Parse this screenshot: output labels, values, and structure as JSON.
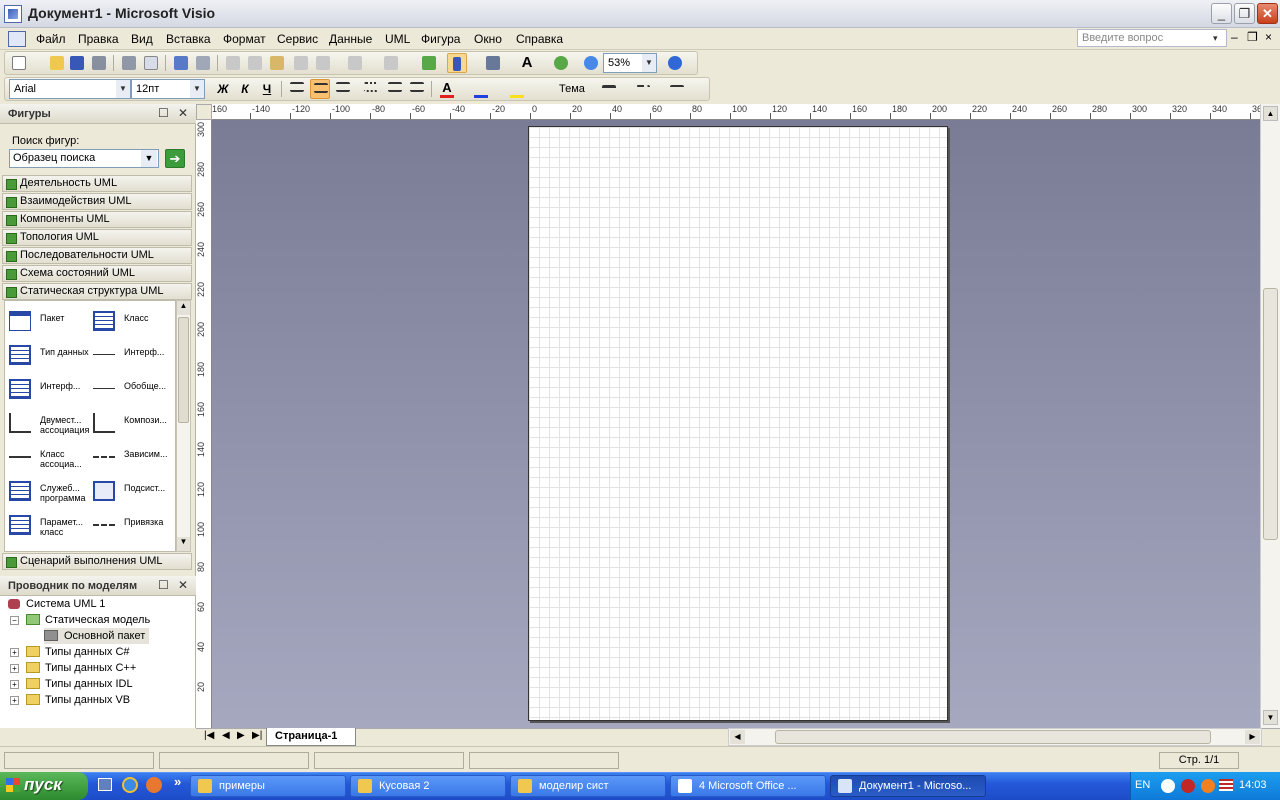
{
  "window": {
    "title": "Документ1 - Microsoft Visio",
    "minimize": "_",
    "restore": "❐",
    "close": "✕"
  },
  "menubar": {
    "items": [
      "Файл",
      "Правка",
      "Вид",
      "Вставка",
      "Формат",
      "Сервис",
      "Данные",
      "UML",
      "Фигура",
      "Окно",
      "Справка"
    ],
    "help_placeholder": "Введите вопрос",
    "help_arrow": "▾",
    "doc_minimize": "–",
    "doc_restore": "❐",
    "doc_close": "×"
  },
  "toolbar": {
    "zoom": "53%",
    "theme_label": "Тема"
  },
  "format_toolbar": {
    "font": "Arial",
    "font_size": "12пт",
    "bold": "Ж",
    "italic": "К",
    "underline": "Ч",
    "text_color": "#e02020",
    "line_color": "#2040e0",
    "fill_color": "#f8e020"
  },
  "shapes_panel": {
    "title": "Фигуры",
    "search_label": "Поиск фигур:",
    "search_value": "Образец поиска",
    "search_go": "➔",
    "stencils": [
      "Деятельность UML",
      "Взаимодействия UML",
      "Компоненты UML",
      "Топология UML",
      "Последовательности UML",
      "Схема состояний UML",
      "Статическая структура UML"
    ],
    "bottom_stencil": "Сценарий выполнения UML",
    "shapes": [
      {
        "label": "Пакет",
        "icon": "package-icon"
      },
      {
        "label": "Класс",
        "icon": "class-icon"
      },
      {
        "label": "Тип данных",
        "icon": "datatype-icon"
      },
      {
        "label": "Интерф...",
        "icon": "interface-lollipop-icon"
      },
      {
        "label": "Интерф...",
        "icon": "interface-class-icon"
      },
      {
        "label": "Обобще...",
        "icon": "generalization-icon"
      },
      {
        "label": "Двумест... ассоциация",
        "icon": "binary-association-icon"
      },
      {
        "label": "Компози...",
        "icon": "composition-icon"
      },
      {
        "label": "Класс ассоциа...",
        "icon": "association-class-icon"
      },
      {
        "label": "Зависим...",
        "icon": "dependency-icon"
      },
      {
        "label": "Служеб... программа",
        "icon": "utility-icon"
      },
      {
        "label": "Подсист...",
        "icon": "subsystem-icon"
      },
      {
        "label": "Парамет... класс",
        "icon": "parameterized-class-icon"
      },
      {
        "label": "Привязка",
        "icon": "binding-icon"
      }
    ]
  },
  "explorer": {
    "title": "Проводник по моделям",
    "root": "Система UML 1",
    "static_model": "Статическая модель",
    "main_package": "Основной пакет",
    "folders": [
      "Типы данных C#",
      "Типы данных C++",
      "Типы данных IDL",
      "Типы данных VB"
    ]
  },
  "ruler": {
    "h_labels": [
      "160",
      "-140",
      "-120",
      "-100",
      "-80",
      "-60",
      "-40",
      "-20",
      "0",
      "20",
      "40",
      "60",
      "80",
      "100",
      "120",
      "140",
      "160",
      "180",
      "200",
      "220",
      "240",
      "260",
      "280",
      "300",
      "320",
      "340",
      "36"
    ],
    "v_labels": [
      "300",
      "280",
      "260",
      "240",
      "220",
      "200",
      "180",
      "160",
      "140",
      "120",
      "100",
      "80",
      "60",
      "40",
      "20"
    ]
  },
  "page_tab": "Страница-1",
  "status": {
    "page": "Стр. 1/1"
  },
  "taskbar": {
    "start": "пуск",
    "more": "»",
    "tasks": [
      {
        "label": "примеры",
        "icon_color": "#f0c850"
      },
      {
        "label": "Кусовая 2",
        "icon_color": "#f0c850"
      },
      {
        "label": "моделир сист",
        "icon_color": "#f0c850"
      },
      {
        "label": "4 Microsoft Office ...",
        "icon_color": "#ffffff"
      },
      {
        "label": "Документ1 - Microso...",
        "icon_color": "#d8e4f8"
      }
    ],
    "lang": "EN",
    "time": "14:03"
  }
}
